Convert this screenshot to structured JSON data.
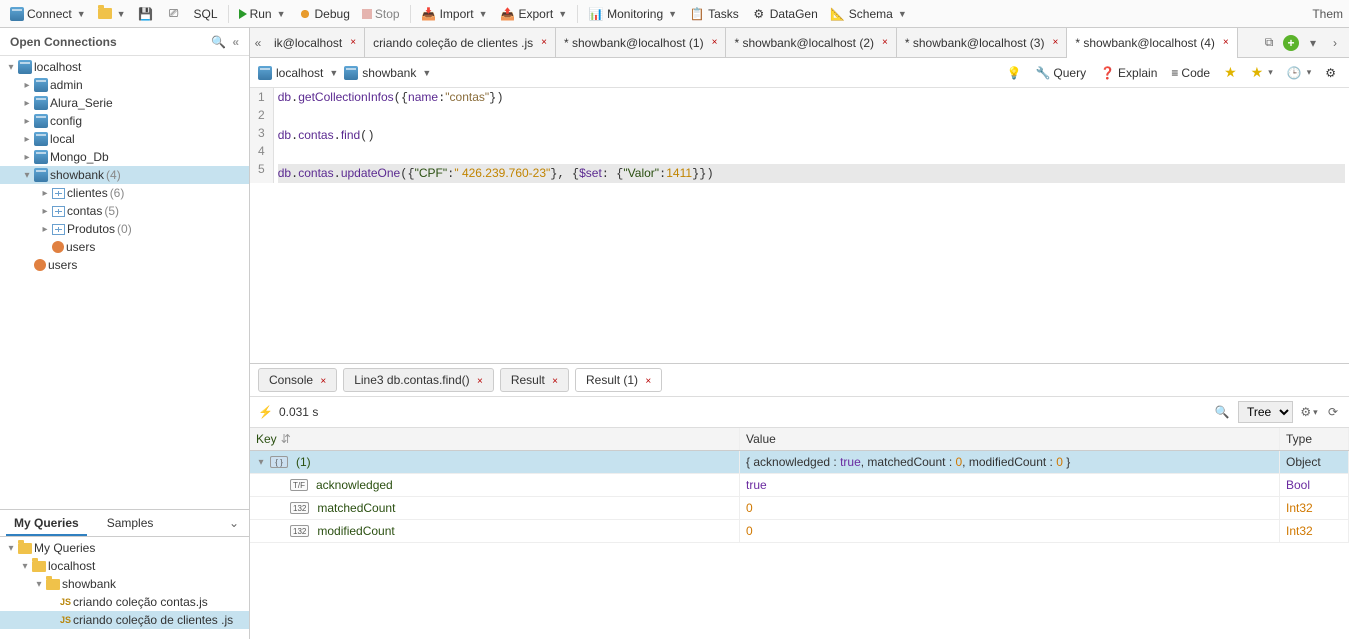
{
  "toolbar": {
    "connect": "Connect",
    "sql": "SQL",
    "run": "Run",
    "debug": "Debug",
    "stop": "Stop",
    "import": "Import",
    "export": "Export",
    "monitoring": "Monitoring",
    "tasks": "Tasks",
    "datagen": "DataGen",
    "schema": "Schema",
    "theme": "Them"
  },
  "left": {
    "panel_title": "Open Connections",
    "tree": {
      "conn": "localhost",
      "dbs": [
        {
          "name": "admin"
        },
        {
          "name": "Alura_Serie"
        },
        {
          "name": "config"
        },
        {
          "name": "local"
        },
        {
          "name": "Mongo_Db"
        }
      ],
      "showbank": {
        "name": "showbank",
        "count": "(4)"
      },
      "collections": [
        {
          "name": "clientes",
          "count": "(6)"
        },
        {
          "name": "contas",
          "count": "(5)"
        },
        {
          "name": "Produtos",
          "count": "(0)"
        }
      ],
      "users_inner": "users",
      "users_outer": "users"
    },
    "queries": {
      "tabs": {
        "mine": "My Queries",
        "samples": "Samples"
      },
      "root": "My Queries",
      "conn": "localhost",
      "folder": "showbank",
      "files": [
        "criando coleção contas.js",
        "criando coleção de clientes .js"
      ]
    }
  },
  "tabs": [
    {
      "label": "ik@localhost"
    },
    {
      "label": "criando coleção de clientes .js"
    },
    {
      "label": "* showbank@localhost (1)"
    },
    {
      "label": "* showbank@localhost (2)"
    },
    {
      "label": "* showbank@localhost (3)"
    },
    {
      "label": "* showbank@localhost (4)",
      "active": true
    }
  ],
  "pathbar": {
    "host": "localhost",
    "db": "showbank",
    "btns": {
      "query": "Query",
      "explain": "Explain",
      "code": "Code"
    }
  },
  "editor": {
    "lines": [
      "db.getCollectionInfos({name:\"contas\"})",
      "",
      "db.contas.find()",
      "",
      "db.contas.updateOne({\"CPF\":\" 426.239.760-23\"}, {$set: {\"Valor\":1411}})"
    ]
  },
  "results": {
    "tabs": {
      "console": "Console",
      "line3": "Line3 db.contas.find()",
      "result": "Result",
      "result1": "Result (1)"
    },
    "time": "0.031 s",
    "view_mode": "Tree",
    "columns": {
      "key": "Key",
      "value": "Value",
      "type": "Type"
    },
    "rows": {
      "root": {
        "key": "(1)",
        "value": "{ acknowledged : true, matchedCount : 0, modifiedCount : 0 }",
        "type": "Object"
      },
      "acknowledged": {
        "key": "acknowledged",
        "value": "true",
        "type": "Bool"
      },
      "matchedCount": {
        "key": "matchedCount",
        "value": "0",
        "type": "Int32"
      },
      "modifiedCount": {
        "key": "modifiedCount",
        "value": "0",
        "type": "Int32"
      }
    }
  }
}
